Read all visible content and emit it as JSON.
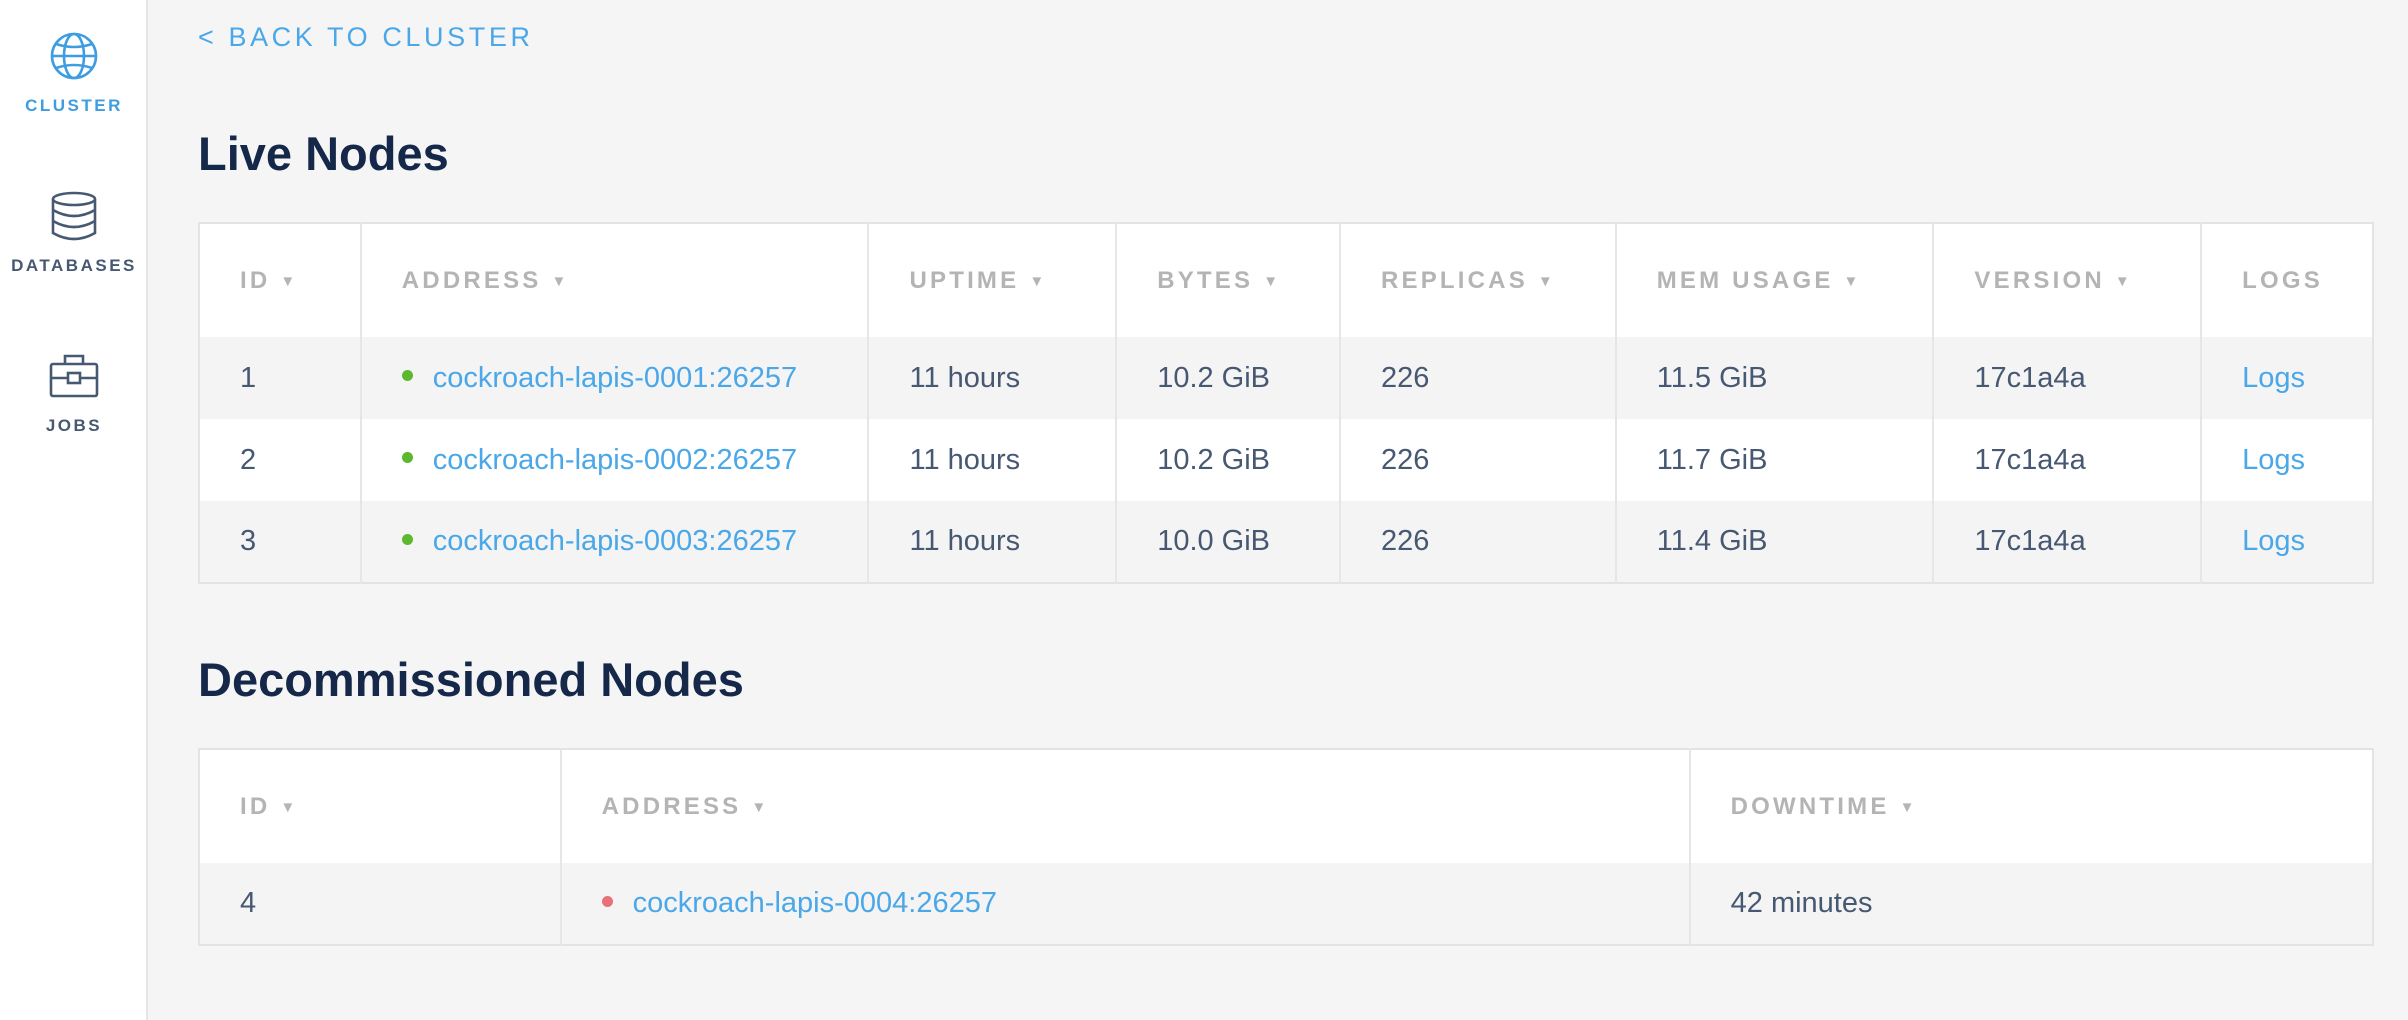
{
  "sidebar": {
    "items": [
      {
        "label": "CLUSTER",
        "icon": "globe-icon",
        "active": true
      },
      {
        "label": "DATABASES",
        "icon": "database-icon",
        "active": false
      },
      {
        "label": "JOBS",
        "icon": "briefcase-icon",
        "active": false
      }
    ]
  },
  "back_link": "< BACK TO CLUSTER",
  "live": {
    "title": "Live Nodes",
    "columns": [
      "ID",
      "ADDRESS",
      "UPTIME",
      "BYTES",
      "REPLICAS",
      "MEM USAGE",
      "VERSION",
      "LOGS"
    ],
    "rows": [
      {
        "id": "1",
        "address": "cockroach-lapis-0001:26257",
        "uptime": "11 hours",
        "bytes": "10.2 GiB",
        "replicas": "226",
        "mem": "11.5 GiB",
        "version": "17c1a4a",
        "logs": "Logs"
      },
      {
        "id": "2",
        "address": "cockroach-lapis-0002:26257",
        "uptime": "11 hours",
        "bytes": "10.2 GiB",
        "replicas": "226",
        "mem": "11.7 GiB",
        "version": "17c1a4a",
        "logs": "Logs"
      },
      {
        "id": "3",
        "address": "cockroach-lapis-0003:26257",
        "uptime": "11 hours",
        "bytes": "10.0 GiB",
        "replicas": "226",
        "mem": "11.4 GiB",
        "version": "17c1a4a",
        "logs": "Logs"
      }
    ]
  },
  "decommissioned": {
    "title": "Decommissioned Nodes",
    "columns": [
      "ID",
      "ADDRESS",
      "DOWNTIME"
    ],
    "rows": [
      {
        "id": "4",
        "address": "cockroach-lapis-0004:26257",
        "downtime": "42 minutes"
      }
    ]
  },
  "colors": {
    "accent": "#4aa7e8",
    "live_status": "#5cb82d",
    "dead_status": "#e8707a",
    "title": "#152849",
    "text": "#475872"
  }
}
